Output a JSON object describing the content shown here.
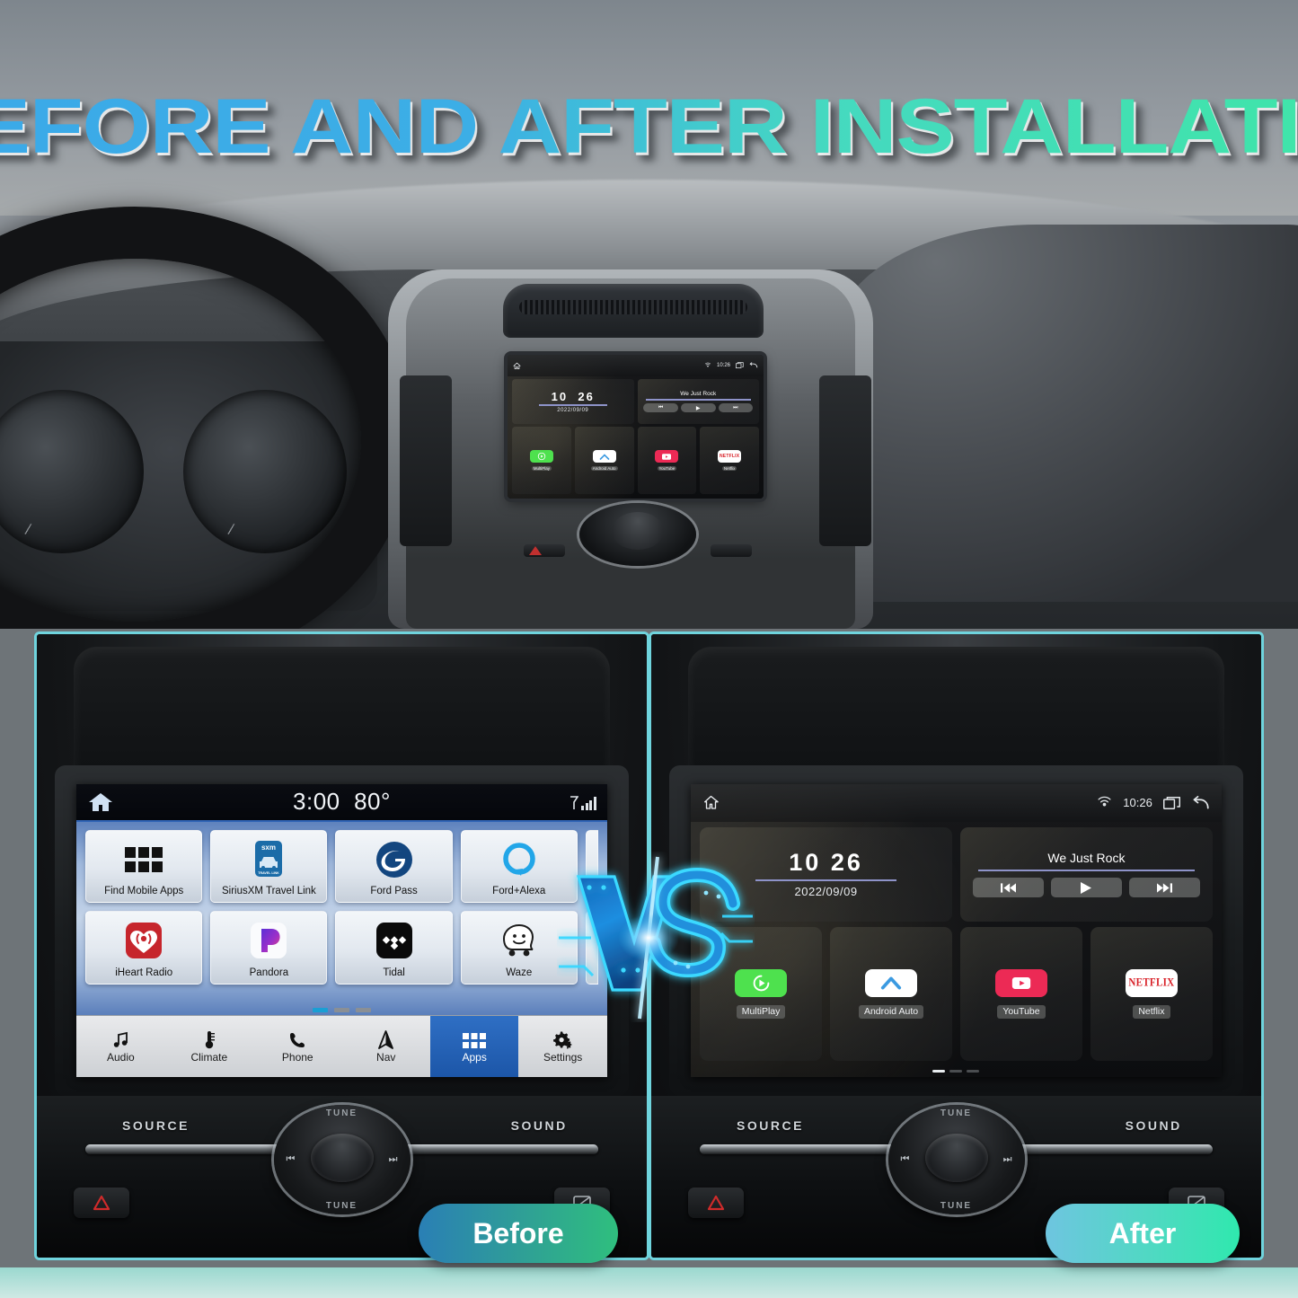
{
  "page": {
    "title": "BEFORE AND AFTER INSTALLATION",
    "accent_cyan": "#6fd4dd",
    "title_gradient_from": "#3BA9E8",
    "title_gradient_to": "#3FE6A6"
  },
  "vs_badge": {
    "label": "VS",
    "glow_color": "#2bb8f0"
  },
  "labels": {
    "before": "Before",
    "after": "After"
  },
  "before_screen": {
    "system": "SYNC 3",
    "status_bar": {
      "home_icon": "home-icon",
      "time": "3:00",
      "temperature": "80°",
      "signal_icon": "signal-bars-icon"
    },
    "apps": [
      {
        "label": "Find Mobile Apps",
        "icon": "grid-apps-icon"
      },
      {
        "label": "SiriusXM Travel Link",
        "icon": "siriusxm-icon",
        "badge_top": "sxm",
        "badge_bottom": "TRAVEL LINK"
      },
      {
        "label": "Ford Pass",
        "icon": "fordpass-icon"
      },
      {
        "label": "Ford+Alexa",
        "icon": "alexa-ring-icon"
      },
      {
        "label": "iHeart Radio",
        "icon": "iheartradio-icon"
      },
      {
        "label": "Pandora",
        "icon": "pandora-icon"
      },
      {
        "label": "Tidal",
        "icon": "tidal-icon"
      },
      {
        "label": "Waze",
        "icon": "waze-icon"
      }
    ],
    "page_dots": {
      "count": 3,
      "active_index": 0
    },
    "nav": [
      {
        "label": "Audio",
        "icon": "music-note-icon",
        "active": false
      },
      {
        "label": "Climate",
        "icon": "thermometer-icon",
        "active": false
      },
      {
        "label": "Phone",
        "icon": "phone-icon",
        "active": false
      },
      {
        "label": "Nav",
        "icon": "navigation-arrow-icon",
        "active": false
      },
      {
        "label": "Apps",
        "icon": "grid-apps-icon",
        "active": true
      },
      {
        "label": "Settings",
        "icon": "gear-icon",
        "active": false
      }
    ]
  },
  "after_screen": {
    "system": "Android Head Unit",
    "status_bar": {
      "home_icon": "home-outline-icon",
      "cast_icon": "wireless-cast-icon",
      "time": "10:26",
      "recents_icon": "recent-apps-icon",
      "back_icon": "back-arrow-icon"
    },
    "clock_widget": {
      "hours": "10",
      "minutes": "26",
      "date": "2022/09/09"
    },
    "media_widget": {
      "track_title": "We Just Rock",
      "prev_icon": "skip-previous-icon",
      "play_icon": "play-icon",
      "next_icon": "skip-next-icon"
    },
    "apps": [
      {
        "label": "MultiPlay",
        "icon": "multiplay-icon",
        "color": "#4ee14e"
      },
      {
        "label": "Android Auto",
        "icon": "androidauto-icon",
        "color": "#ffffff"
      },
      {
        "label": "YouTube",
        "icon": "youtube-icon",
        "color": "#ec2a55"
      },
      {
        "label": "Netflix",
        "icon": "netflix-icon",
        "color": "#ffffff"
      }
    ],
    "page_dots": {
      "count": 3,
      "active_index": 0
    }
  },
  "console": {
    "source_label": "SOURCE",
    "sound_label": "SOUND",
    "tune_up_label": "TUNE",
    "tune_down_label": "TUNE",
    "hazard_icon": "hazard-triangle-icon",
    "display_off_icon": "screen-off-icon"
  }
}
